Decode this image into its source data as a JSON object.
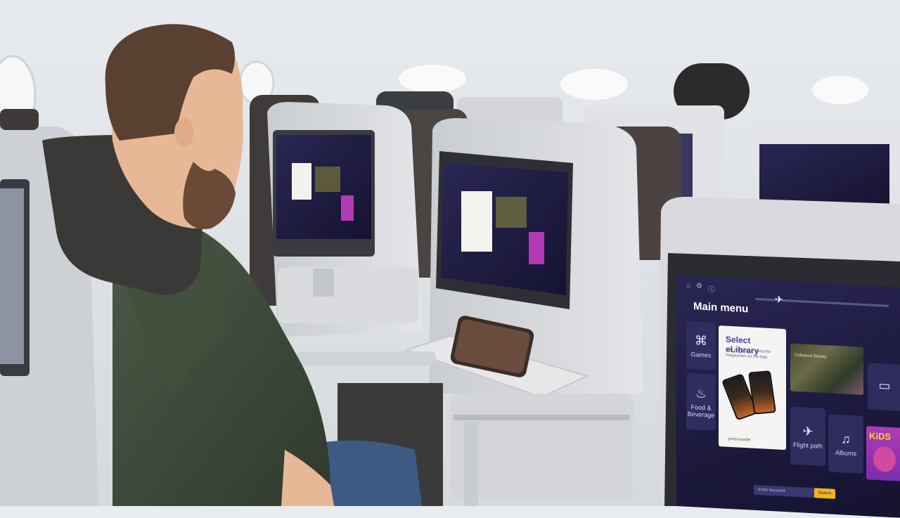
{
  "ife": {
    "topbar_icons": [
      "home-icon",
      "settings-icon",
      "info-icon"
    ],
    "title": "Main menu",
    "tiles": [
      {
        "id": "games",
        "label": "Games",
        "icon": "gamepad-icon",
        "glyph": "⌘"
      },
      {
        "id": "food",
        "label": "Food & Beverage",
        "icon": "cloche-icon",
        "glyph": "♨"
      },
      {
        "id": "flight",
        "label": "Flight path",
        "icon": "airplane-icon",
        "glyph": "✈"
      },
      {
        "id": "albums",
        "label": "Albums",
        "icon": "music-note-icon",
        "glyph": "♫"
      },
      {
        "id": "tv",
        "label": "",
        "icon": "tv-icon",
        "glyph": "▭"
      }
    ],
    "elibrary": {
      "title": "Select eLibrary",
      "subtitle": "and enjoy your favourite magazines on the App",
      "brand": "pressreader"
    },
    "trailer_title": "Collateral Beauty",
    "kids_label": "KiDS",
    "search_placeholder": "Enter keyword",
    "search_button": "Search"
  }
}
